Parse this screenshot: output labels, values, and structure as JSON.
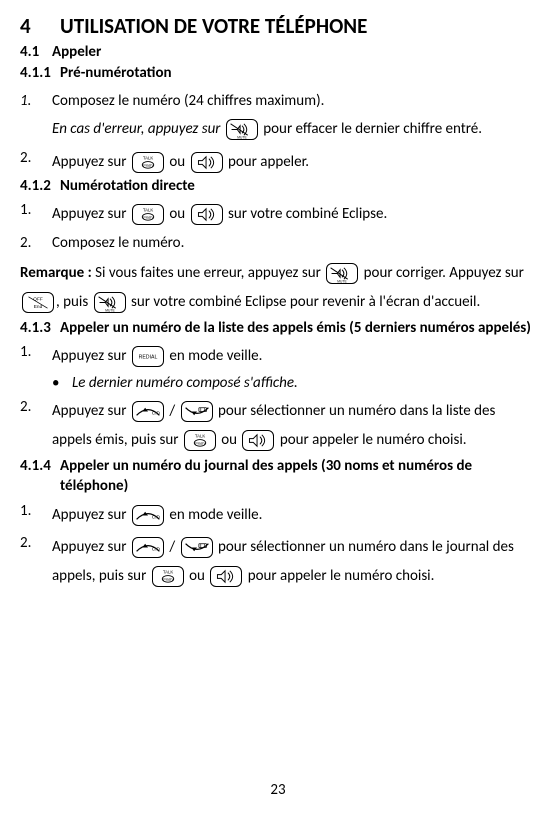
{
  "h1_num": "4",
  "h1_title": "UTILISATION DE VOTRE TÉLÉPHONE",
  "h2_num": "4.1",
  "h2_title": "Appeler",
  "s411_num": "4.1.1",
  "s411_title": "Pré-numérotation",
  "s411_l1_num": "1.",
  "s411_l1a": "Composez le numéro (24 chiffres maximum).",
  "s411_l1b_a": "En cas d'erreur, appuyez sur",
  "s411_l1b_b": "pour effacer le dernier chiffre entré.",
  "s411_l2_num": "2.",
  "s411_l2_a": "Appuyez sur",
  "s411_l2_b": "ou",
  "s411_l2_c": "pour appeler.",
  "s412_num": "4.1.2",
  "s412_title": "Numérotation directe",
  "s412_l1_num": "1.",
  "s412_l1_a": "Appuyez sur",
  "s412_l1_b": "ou",
  "s412_l1_c": "sur votre combiné Eclipse.",
  "s412_l2_num": "2.",
  "s412_l2": "Composez le numéro.",
  "remark_label": "Remarque :",
  "remark_a": "Si vous faites une erreur, appuyez sur",
  "remark_b": "pour corriger. Appuyez sur",
  "remark_c": ", puis",
  "remark_d": "sur votre combiné Eclipse pour revenir à l'écran d'accueil.",
  "s413_num": "4.1.3",
  "s413_title": "Appeler un numéro de la liste des appels émis (5 derniers numéros appelés)",
  "s413_l1_num": "1.",
  "s413_l1_a": "Appuyez sur",
  "s413_l1_b": "en mode veille.",
  "s413_bullet": "•",
  "s413_sub": "Le dernier numéro composé s'affiche.",
  "s413_l2_num": "2.",
  "s413_l2_a": "Appuyez sur",
  "s413_l2_b": "/",
  "s413_l2_c": "pour sélectionner un numéro dans la liste des appels émis, puis sur",
  "s413_l2_d": "ou",
  "s413_l2_e": "pour appeler le numéro choisi.",
  "s414_num": "4.1.4",
  "s414_title": "Appeler un numéro du journal des appels (30 noms et numéros de téléphone)",
  "s414_l1_num": "1.",
  "s414_l1_a": "Appuyez sur",
  "s414_l1_b": "en mode veille.",
  "s414_l2_num": "2.",
  "s414_l2_a": "Appuyez sur",
  "s414_l2_b": "/",
  "s414_l2_c": "pour sélectionner un numéro dans le journal des appels, puis sur",
  "s414_l2_d": "ou",
  "s414_l2_e": "pour appeler le numéro choisi.",
  "page": "23"
}
